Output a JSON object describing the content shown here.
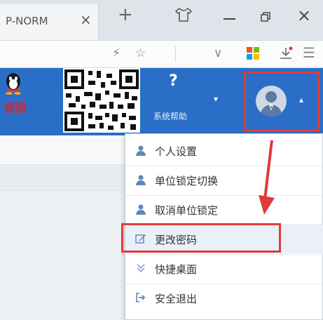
{
  "browser": {
    "tab_title": "P-NORM",
    "tab_close_glyph": "×",
    "new_tab_glyph": "+",
    "close_window_glyph": "×"
  },
  "toolbar": {
    "icons": [
      "flash-icon",
      "star-icon",
      "chevron-down-icon",
      "apps-icon",
      "download-icon",
      "hamburger-menu-icon"
    ],
    "bolt_glyph": "⚡",
    "star_glyph": "☆",
    "chevron_glyph": "∨",
    "menu_glyph": "☰"
  },
  "header": {
    "kefu_label": "客服",
    "help_question": "?",
    "help_label": "系统帮助",
    "caret_glyph": "▾",
    "user_caret_glyph": "▴",
    "brand_color": "#2a6ec7"
  },
  "user_menu": {
    "items": [
      {
        "label": "个人设置",
        "icon": "user-icon"
      },
      {
        "label": "单位锁定切换",
        "icon": "user-icon"
      },
      {
        "label": "取消单位锁定",
        "icon": "user-icon"
      },
      {
        "label": "更改密码",
        "icon": "edit-icon",
        "highlighted": true
      },
      {
        "label": "快捷桌面",
        "icon": "double-chevron-down-icon"
      },
      {
        "label": "安全退出",
        "icon": "logout-icon"
      }
    ]
  },
  "annotation": {
    "highlight_color": "#e03b3b"
  }
}
